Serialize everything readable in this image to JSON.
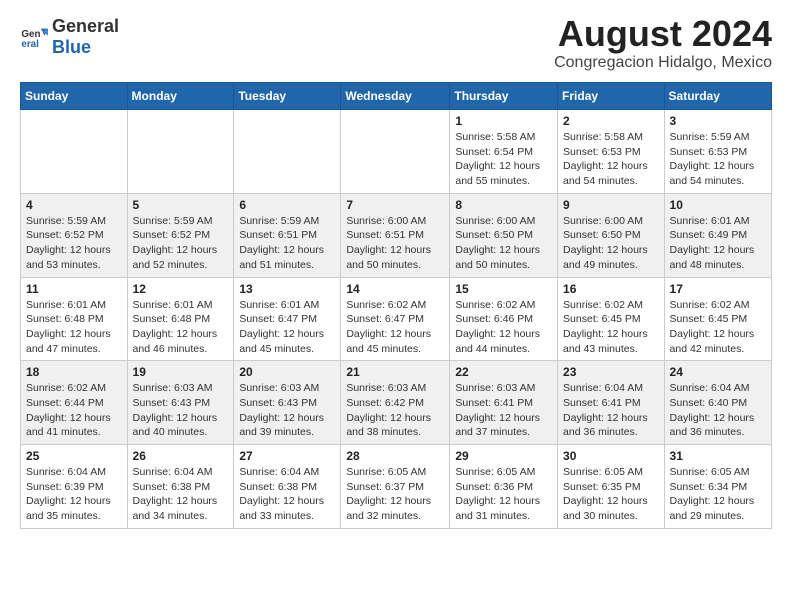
{
  "logo": {
    "general": "General",
    "blue": "Blue"
  },
  "header": {
    "month_year": "August 2024",
    "location": "Congregacion Hidalgo, Mexico"
  },
  "weekdays": [
    "Sunday",
    "Monday",
    "Tuesday",
    "Wednesday",
    "Thursday",
    "Friday",
    "Saturday"
  ],
  "weeks": [
    [
      {
        "day": "",
        "info": ""
      },
      {
        "day": "",
        "info": ""
      },
      {
        "day": "",
        "info": ""
      },
      {
        "day": "",
        "info": ""
      },
      {
        "day": "1",
        "info": "Sunrise: 5:58 AM\nSunset: 6:54 PM\nDaylight: 12 hours\nand 55 minutes."
      },
      {
        "day": "2",
        "info": "Sunrise: 5:58 AM\nSunset: 6:53 PM\nDaylight: 12 hours\nand 54 minutes."
      },
      {
        "day": "3",
        "info": "Sunrise: 5:59 AM\nSunset: 6:53 PM\nDaylight: 12 hours\nand 54 minutes."
      }
    ],
    [
      {
        "day": "4",
        "info": "Sunrise: 5:59 AM\nSunset: 6:52 PM\nDaylight: 12 hours\nand 53 minutes."
      },
      {
        "day": "5",
        "info": "Sunrise: 5:59 AM\nSunset: 6:52 PM\nDaylight: 12 hours\nand 52 minutes."
      },
      {
        "day": "6",
        "info": "Sunrise: 5:59 AM\nSunset: 6:51 PM\nDaylight: 12 hours\nand 51 minutes."
      },
      {
        "day": "7",
        "info": "Sunrise: 6:00 AM\nSunset: 6:51 PM\nDaylight: 12 hours\nand 50 minutes."
      },
      {
        "day": "8",
        "info": "Sunrise: 6:00 AM\nSunset: 6:50 PM\nDaylight: 12 hours\nand 50 minutes."
      },
      {
        "day": "9",
        "info": "Sunrise: 6:00 AM\nSunset: 6:50 PM\nDaylight: 12 hours\nand 49 minutes."
      },
      {
        "day": "10",
        "info": "Sunrise: 6:01 AM\nSunset: 6:49 PM\nDaylight: 12 hours\nand 48 minutes."
      }
    ],
    [
      {
        "day": "11",
        "info": "Sunrise: 6:01 AM\nSunset: 6:48 PM\nDaylight: 12 hours\nand 47 minutes."
      },
      {
        "day": "12",
        "info": "Sunrise: 6:01 AM\nSunset: 6:48 PM\nDaylight: 12 hours\nand 46 minutes."
      },
      {
        "day": "13",
        "info": "Sunrise: 6:01 AM\nSunset: 6:47 PM\nDaylight: 12 hours\nand 45 minutes."
      },
      {
        "day": "14",
        "info": "Sunrise: 6:02 AM\nSunset: 6:47 PM\nDaylight: 12 hours\nand 45 minutes."
      },
      {
        "day": "15",
        "info": "Sunrise: 6:02 AM\nSunset: 6:46 PM\nDaylight: 12 hours\nand 44 minutes."
      },
      {
        "day": "16",
        "info": "Sunrise: 6:02 AM\nSunset: 6:45 PM\nDaylight: 12 hours\nand 43 minutes."
      },
      {
        "day": "17",
        "info": "Sunrise: 6:02 AM\nSunset: 6:45 PM\nDaylight: 12 hours\nand 42 minutes."
      }
    ],
    [
      {
        "day": "18",
        "info": "Sunrise: 6:02 AM\nSunset: 6:44 PM\nDaylight: 12 hours\nand 41 minutes."
      },
      {
        "day": "19",
        "info": "Sunrise: 6:03 AM\nSunset: 6:43 PM\nDaylight: 12 hours\nand 40 minutes."
      },
      {
        "day": "20",
        "info": "Sunrise: 6:03 AM\nSunset: 6:43 PM\nDaylight: 12 hours\nand 39 minutes."
      },
      {
        "day": "21",
        "info": "Sunrise: 6:03 AM\nSunset: 6:42 PM\nDaylight: 12 hours\nand 38 minutes."
      },
      {
        "day": "22",
        "info": "Sunrise: 6:03 AM\nSunset: 6:41 PM\nDaylight: 12 hours\nand 37 minutes."
      },
      {
        "day": "23",
        "info": "Sunrise: 6:04 AM\nSunset: 6:41 PM\nDaylight: 12 hours\nand 36 minutes."
      },
      {
        "day": "24",
        "info": "Sunrise: 6:04 AM\nSunset: 6:40 PM\nDaylight: 12 hours\nand 36 minutes."
      }
    ],
    [
      {
        "day": "25",
        "info": "Sunrise: 6:04 AM\nSunset: 6:39 PM\nDaylight: 12 hours\nand 35 minutes."
      },
      {
        "day": "26",
        "info": "Sunrise: 6:04 AM\nSunset: 6:38 PM\nDaylight: 12 hours\nand 34 minutes."
      },
      {
        "day": "27",
        "info": "Sunrise: 6:04 AM\nSunset: 6:38 PM\nDaylight: 12 hours\nand 33 minutes."
      },
      {
        "day": "28",
        "info": "Sunrise: 6:05 AM\nSunset: 6:37 PM\nDaylight: 12 hours\nand 32 minutes."
      },
      {
        "day": "29",
        "info": "Sunrise: 6:05 AM\nSunset: 6:36 PM\nDaylight: 12 hours\nand 31 minutes."
      },
      {
        "day": "30",
        "info": "Sunrise: 6:05 AM\nSunset: 6:35 PM\nDaylight: 12 hours\nand 30 minutes."
      },
      {
        "day": "31",
        "info": "Sunrise: 6:05 AM\nSunset: 6:34 PM\nDaylight: 12 hours\nand 29 minutes."
      }
    ]
  ]
}
